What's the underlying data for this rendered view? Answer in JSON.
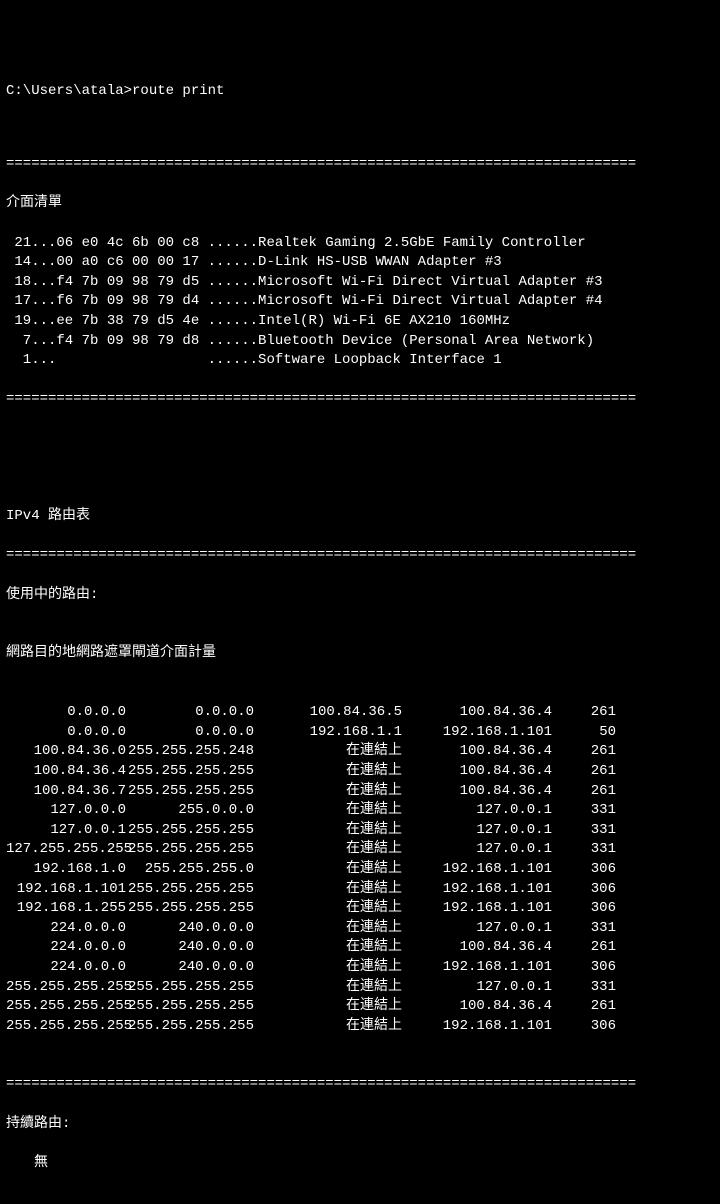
{
  "prompt": "C:\\Users\\atala>route print",
  "sections": {
    "interfaces_title": "介面清單",
    "ipv4_title": "IPv4 路由表",
    "active_routes_title": "使用中的路由:",
    "persistent_routes_title": "持續路由:",
    "persistent_none": "無"
  },
  "headers": {
    "dest": "網路目的地",
    "mask": "網路遮罩",
    "gateway": "閘道",
    "interface": "介面",
    "metric": "計量"
  },
  "interfaces": [
    {
      "idx": " 21",
      "mac": "06 e0 4c 6b 00 c8",
      "name": "Realtek Gaming 2.5GbE Family Controller"
    },
    {
      "idx": " 14",
      "mac": "00 a0 c6 00 00 17",
      "name": "D-Link HS-USB WWAN Adapter #3"
    },
    {
      "idx": " 18",
      "mac": "f4 7b 09 98 79 d5",
      "name": "Microsoft Wi-Fi Direct Virtual Adapter #3"
    },
    {
      "idx": " 17",
      "mac": "f6 7b 09 98 79 d4",
      "name": "Microsoft Wi-Fi Direct Virtual Adapter #4"
    },
    {
      "idx": " 19",
      "mac": "ee 7b 38 79 d5 4e",
      "name": "Intel(R) Wi-Fi 6E AX210 160MHz"
    },
    {
      "idx": "  7",
      "mac": "f4 7b 09 98 79 d8",
      "name": "Bluetooth Device (Personal Area Network)"
    },
    {
      "idx": "  1",
      "mac": "                 ",
      "name": "Software Loopback Interface 1"
    }
  ],
  "routes": [
    {
      "dest": "0.0.0.0",
      "mask": "0.0.0.0",
      "gateway": "100.84.36.5",
      "iface": "100.84.36.4",
      "metric": "261"
    },
    {
      "dest": "0.0.0.0",
      "mask": "0.0.0.0",
      "gateway": "192.168.1.1",
      "iface": "192.168.1.101",
      "metric": "50"
    },
    {
      "dest": "100.84.36.0",
      "mask": "255.255.255.248",
      "gateway": "在連結上",
      "iface": "100.84.36.4",
      "metric": "261"
    },
    {
      "dest": "100.84.36.4",
      "mask": "255.255.255.255",
      "gateway": "在連結上",
      "iface": "100.84.36.4",
      "metric": "261"
    },
    {
      "dest": "100.84.36.7",
      "mask": "255.255.255.255",
      "gateway": "在連結上",
      "iface": "100.84.36.4",
      "metric": "261"
    },
    {
      "dest": "127.0.0.0",
      "mask": "255.0.0.0",
      "gateway": "在連結上",
      "iface": "127.0.0.1",
      "metric": "331"
    },
    {
      "dest": "127.0.0.1",
      "mask": "255.255.255.255",
      "gateway": "在連結上",
      "iface": "127.0.0.1",
      "metric": "331"
    },
    {
      "dest": "127.255.255.255",
      "mask": "255.255.255.255",
      "gateway": "在連結上",
      "iface": "127.0.0.1",
      "metric": "331"
    },
    {
      "dest": "192.168.1.0",
      "mask": "255.255.255.0",
      "gateway": "在連結上",
      "iface": "192.168.1.101",
      "metric": "306"
    },
    {
      "dest": "192.168.1.101",
      "mask": "255.255.255.255",
      "gateway": "在連結上",
      "iface": "192.168.1.101",
      "metric": "306"
    },
    {
      "dest": "192.168.1.255",
      "mask": "255.255.255.255",
      "gateway": "在連結上",
      "iface": "192.168.1.101",
      "metric": "306"
    },
    {
      "dest": "224.0.0.0",
      "mask": "240.0.0.0",
      "gateway": "在連結上",
      "iface": "127.0.0.1",
      "metric": "331"
    },
    {
      "dest": "224.0.0.0",
      "mask": "240.0.0.0",
      "gateway": "在連結上",
      "iface": "100.84.36.4",
      "metric": "261"
    },
    {
      "dest": "224.0.0.0",
      "mask": "240.0.0.0",
      "gateway": "在連結上",
      "iface": "192.168.1.101",
      "metric": "306"
    },
    {
      "dest": "255.255.255.255",
      "mask": "255.255.255.255",
      "gateway": "在連結上",
      "iface": "127.0.0.1",
      "metric": "331"
    },
    {
      "dest": "255.255.255.255",
      "mask": "255.255.255.255",
      "gateway": "在連結上",
      "iface": "100.84.36.4",
      "metric": "261"
    },
    {
      "dest": "255.255.255.255",
      "mask": "255.255.255.255",
      "gateway": "在連結上",
      "iface": "192.168.1.101",
      "metric": "306"
    }
  ],
  "divider": "==========================================================================="
}
